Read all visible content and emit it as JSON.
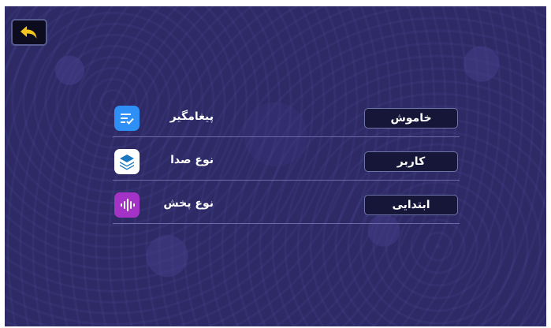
{
  "settings": {
    "items": [
      {
        "label": "پیغامگیر",
        "value": "خاموش",
        "icon": "checklist-icon",
        "icon_color": "#2e8ff7"
      },
      {
        "label": "نوع صدا",
        "value": "کاربر",
        "icon": "layers-icon",
        "icon_color": "#ffffff"
      },
      {
        "label": "نوع پخش",
        "value": "ابتدایی",
        "icon": "waveform-icon",
        "icon_color": "#a233c6"
      }
    ]
  },
  "toolbar": {
    "back_icon": "back-arrow-icon",
    "back_color": "#f4c31c"
  }
}
